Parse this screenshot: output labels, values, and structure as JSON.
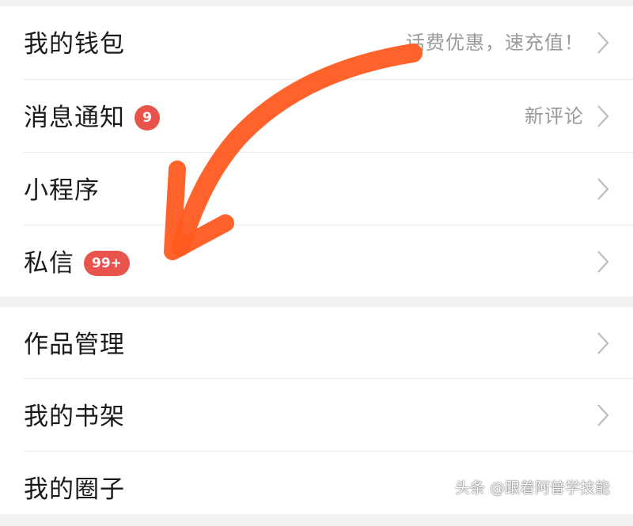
{
  "group1": [
    {
      "label": "我的钱包",
      "hint": "话费优惠，速充值！"
    },
    {
      "label": "消息通知",
      "badge": "9",
      "hint": "新评论"
    },
    {
      "label": "小程序"
    },
    {
      "label": "私信",
      "badge": "99+"
    }
  ],
  "group2": [
    {
      "label": "作品管理"
    },
    {
      "label": "我的书架"
    },
    {
      "label": "我的圈子"
    }
  ],
  "watermark": "头条 @跟着阿普学技能",
  "colors": {
    "background": "#f2f2f2",
    "row": "#ffffff",
    "badge": "#e8534b",
    "hint": "#9a9a9a",
    "annotation_arrow": "#ff5a1f"
  },
  "icons": {
    "row_chevron": "chevron-right-icon"
  }
}
